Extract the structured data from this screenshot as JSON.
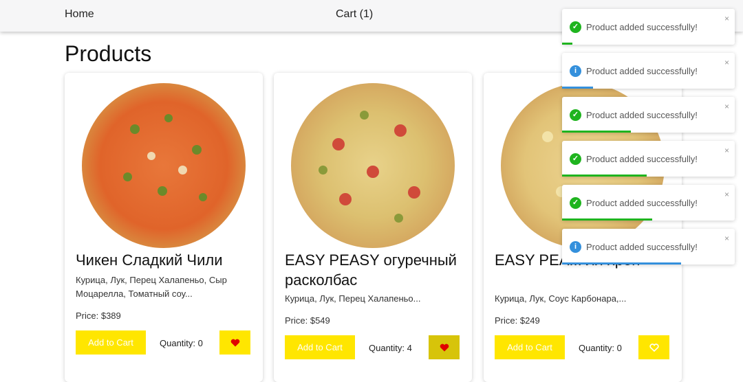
{
  "nav": {
    "home_label": "Home",
    "cart_label": "Cart (1)"
  },
  "page_title": "Products",
  "colors": {
    "accent": "#ffe600",
    "success": "#1fb41f",
    "info": "#3490dc",
    "heart": "#e00000"
  },
  "products": [
    {
      "name": "Чикен Сладкий Чили",
      "description": "Курица, Лук, Перец Халапеньо, Сыр Моцарелла, Томатный соу...",
      "price": "Price: $389",
      "add_label": "Add to Cart",
      "quantity": "Quantity: 0",
      "favorite": true
    },
    {
      "name": "EASY PEASY огуречный расколбас",
      "description": "Курица, Лук, Перец Халапеньо...",
      "price": "Price: $549",
      "add_label": "Add to Cart",
      "quantity": "Quantity: 4",
      "favorite": true
    },
    {
      "name": "EASY PEA... ля хрен",
      "description": "Курица, Лук, Соус Карбонара,...",
      "price": "Price: $249",
      "add_label": "Add to Cart",
      "quantity": "Quantity: 0",
      "favorite": false
    }
  ],
  "toasts": [
    {
      "type": "success",
      "icon": "check-icon",
      "message": "Product added successfully!",
      "close": "×",
      "progress": 0.06
    },
    {
      "type": "info",
      "icon": "info-icon",
      "message": "Product added successfully!",
      "close": "×",
      "progress": 0.18
    },
    {
      "type": "success",
      "icon": "check-icon",
      "message": "Product added successfully!",
      "close": "×",
      "progress": 0.4
    },
    {
      "type": "success",
      "icon": "check-icon",
      "message": "Product added successfully!",
      "close": "×",
      "progress": 0.49
    },
    {
      "type": "success",
      "icon": "check-icon",
      "message": "Product added successfully!",
      "close": "×",
      "progress": 0.52
    },
    {
      "type": "info",
      "icon": "info-icon",
      "message": "Product added successfully!",
      "close": "×",
      "progress": 0.69
    }
  ]
}
